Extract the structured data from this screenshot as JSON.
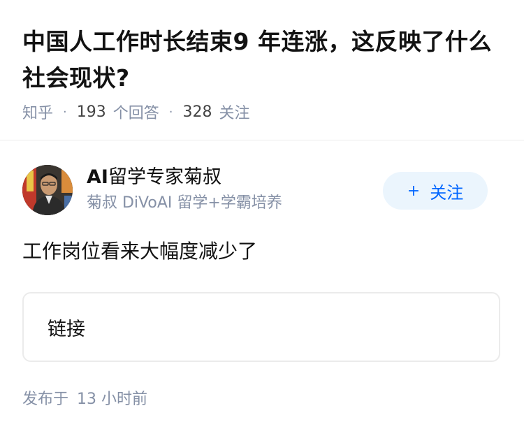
{
  "question": {
    "title": "中国人工作时长结束9 年连涨，这反映了什么社会现状?",
    "source": "知乎",
    "answer_count": "193",
    "answer_count_label": "个回答",
    "follow_count": "328",
    "follow_count_label": "关注",
    "separator": "·"
  },
  "author": {
    "name_prefix": "AI",
    "name_rest": "留学专家菊叔",
    "bio": "菊叔 DiVoAI 留学+学霸培养",
    "follow_plus": "+",
    "follow_label": "关注",
    "avatar_icon": "person-photo"
  },
  "answer": {
    "text": "工作岗位看来大幅度减少了",
    "link_label": "链接"
  },
  "footer": {
    "published_label": "发布于",
    "published_time": "13 小时前"
  },
  "colors": {
    "title": "#121212",
    "meta_gray": "#8590a6",
    "accent_blue": "#0066ff",
    "follow_bg": "#ebf5fd",
    "border": "#ebebeb"
  }
}
